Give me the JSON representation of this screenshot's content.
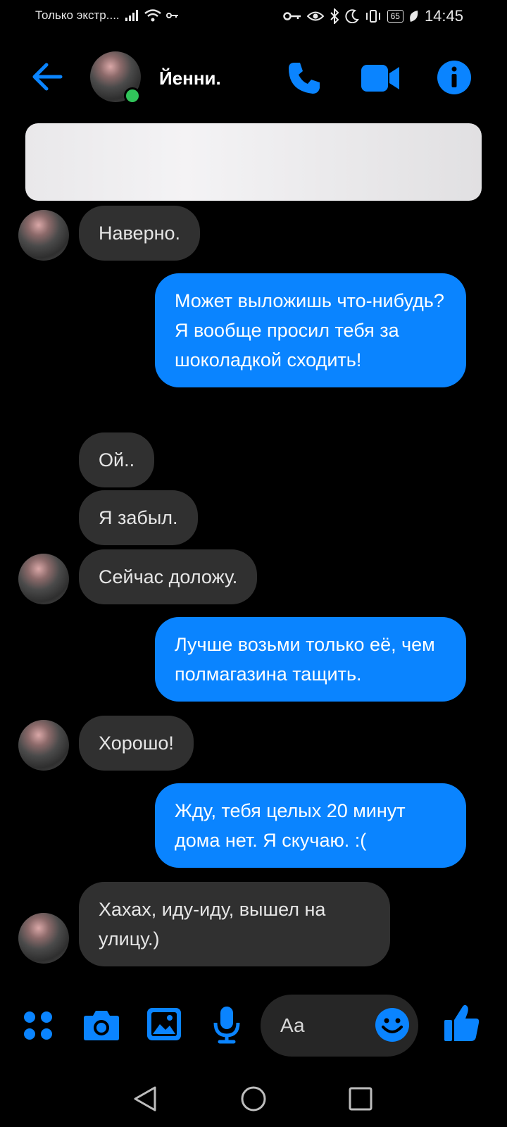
{
  "status_bar": {
    "carrier": "Только экстр....",
    "battery": "65",
    "time": "14:45"
  },
  "header": {
    "contact_name": "Йенни."
  },
  "messages": [
    {
      "from": "them",
      "text": "Наверно."
    },
    {
      "from": "me",
      "text": "Может выложишь что-нибудь? Я вообще просил тебя за шоколадкой сходить!"
    },
    {
      "from": "them",
      "text": "Ой.."
    },
    {
      "from": "them",
      "text": "Я забыл."
    },
    {
      "from": "them",
      "text": "Сейчас доложу."
    },
    {
      "from": "me",
      "text": "Лучше возьми только её, чем полмагазина тащить."
    },
    {
      "from": "them",
      "text": "Хорошо!"
    },
    {
      "from": "me",
      "text": "Жду, тебя целых 20 минут дома нет. Я скучаю. :("
    },
    {
      "from": "them",
      "text": "Хахах, иду-иду, вышел на улицу.)"
    }
  ],
  "composer": {
    "placeholder": "Аа"
  },
  "colors": {
    "accent": "#0a84ff",
    "incoming_bubble": "#303030",
    "background": "#000000",
    "online": "#31c45a"
  },
  "icons": {
    "header": [
      "back-arrow-icon",
      "phone-icon",
      "video-camera-icon",
      "info-icon"
    ],
    "composer": [
      "apps-grid-icon",
      "camera-icon",
      "image-gallery-icon",
      "microphone-icon",
      "emoji-icon",
      "thumbs-up-icon"
    ],
    "navigation": [
      "nav-back-icon",
      "nav-home-icon",
      "nav-recents-icon"
    ]
  }
}
